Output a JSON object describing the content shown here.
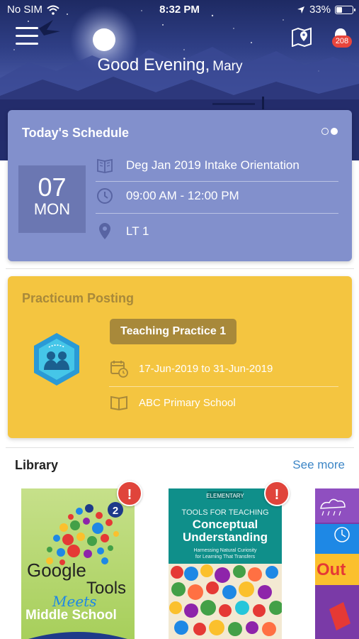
{
  "status_bar": {
    "carrier": "No SIM",
    "time": "8:32 PM",
    "battery": "33%",
    "battery_level": 0.33,
    "icons": [
      "wifi-icon",
      "location-arrow-icon",
      "battery-icon"
    ]
  },
  "header": {
    "greeting": "Good Evening,",
    "user_name": "Mary",
    "notification_count": "208",
    "icons": [
      "hamburger-menu-icon",
      "map-pin-icon",
      "bell-icon"
    ]
  },
  "schedule": {
    "title": "Today's Schedule",
    "page_dots": 2,
    "active_dot": 1,
    "day": "07",
    "weekday": "MON",
    "event": "Deg Jan 2019 Intake Orientation",
    "time": "09:00 AM - 12:00 PM",
    "location": "LT 1",
    "icons": [
      "book-icon",
      "clock-icon",
      "location-pin-icon"
    ]
  },
  "practicum": {
    "title": "Practicum Posting",
    "badge": "Teaching Practice 1",
    "dates": "17-Jun-2019 to 31-Jun-2019",
    "school": "ABC Primary School",
    "icons": [
      "teaching-hexagon-icon",
      "calendar-icon",
      "book-icon"
    ]
  },
  "library": {
    "title": "Library",
    "see_more": "See more",
    "books": [
      {
        "alert": "!",
        "cover_lines": [
          "Google",
          "Tools",
          "Meets",
          "Middle School"
        ],
        "edition": "2"
      },
      {
        "alert": "!",
        "cover_lines": [
          "ELEMENTARY",
          "TOOLS FOR TEACHING",
          "Conceptual",
          "Understanding",
          "Harnessing Natural Curiosity",
          "for Learning That Transfers"
        ]
      },
      {
        "cover_lines": [
          "Out"
        ]
      }
    ]
  },
  "colors": {
    "schedule_card": "#8290cc",
    "date_box": "#6b77b2",
    "practicum_card": "#f4c540",
    "practicum_accent": "#a8893a",
    "link": "#3d86c6",
    "alert": "#e0443b"
  }
}
